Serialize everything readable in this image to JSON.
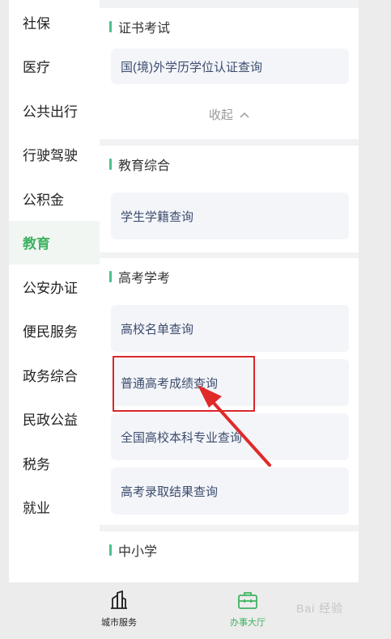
{
  "sidebar": {
    "items": [
      {
        "label": "社保"
      },
      {
        "label": "医疗"
      },
      {
        "label": "公共出行"
      },
      {
        "label": "行驶驾驶"
      },
      {
        "label": "公积金"
      },
      {
        "label": "教育"
      },
      {
        "label": "公安办证"
      },
      {
        "label": "便民服务"
      },
      {
        "label": "政务综合"
      },
      {
        "label": "民政公益"
      },
      {
        "label": "税务"
      },
      {
        "label": "就业"
      }
    ],
    "active_index": 5
  },
  "sections": {
    "certificate": {
      "title": "证书考试",
      "items": [
        "国(境)外学历学位认证查询"
      ],
      "collapse_label": "收起"
    },
    "education": {
      "title": "教育综合",
      "items": [
        "学生学籍查询"
      ]
    },
    "gaokao": {
      "title": "高考学考",
      "items": [
        "高校名单查询",
        "普通高考成绩查询",
        "全国高校本科专业查询",
        "高考录取结果查询"
      ]
    },
    "school": {
      "title": "中小学"
    }
  },
  "tabbar": {
    "city_label": "城市服务",
    "hall_label": "办事大厅",
    "active_color": "#3fb361"
  },
  "icons": {
    "city": "city-building-icon",
    "hall": "briefcase-icon",
    "collapse": "chevron-up-icon"
  },
  "watermark": "Bai 经验"
}
